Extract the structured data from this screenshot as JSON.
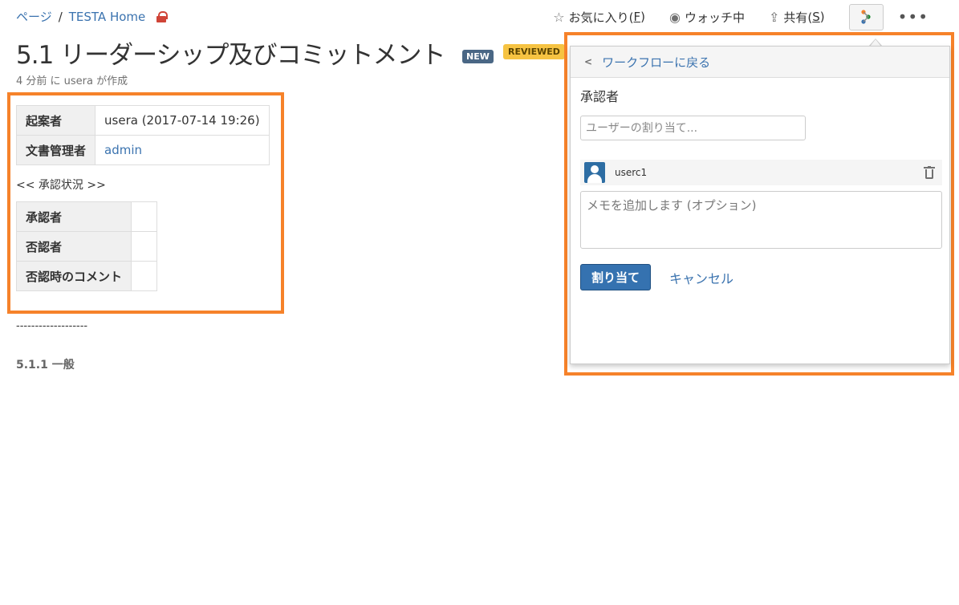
{
  "breadcrumb": {
    "pages": "ページ",
    "sep": "/",
    "space": "TESTA Home",
    "lock_icon": "lock-icon"
  },
  "actions": {
    "favorite": {
      "icon": "☆",
      "label": "お気に入り(",
      "key": "F",
      "end": ")"
    },
    "watch": {
      "icon": "◉",
      "label": "ウォッチ中"
    },
    "share": {
      "icon": "⇪",
      "label": "共有(",
      "key": "S",
      "end": ")"
    },
    "workflow_icon": "workflow-icon",
    "more": "•••"
  },
  "page": {
    "title": "5.1 リーダーシップ及びコミットメント",
    "badge_new": "NEW",
    "badge_reviewed": "REVIEWED",
    "meta": "4 分前 に usera が作成"
  },
  "info_table": [
    {
      "label": "起案者",
      "value": "usera (2017-07-14 19:26)",
      "link": false
    },
    {
      "label": "文書管理者",
      "value": "admin",
      "link": true
    }
  ],
  "status_label": "<< 承認状況 >>",
  "approval_table": [
    {
      "label": "承認者",
      "value": ""
    },
    {
      "label": "否認者",
      "value": ""
    },
    {
      "label": "否認時のコメント",
      "value": ""
    }
  ],
  "body": {
    "dashes": "-------------------",
    "subheading": "5.1.1 一般"
  },
  "panel": {
    "back": "ワークフローに戻る",
    "label": "承認者",
    "user_placeholder": "ユーザーの割り当て...",
    "assigned_user": "userc1",
    "note_placeholder": "メモを追加します (オプション)",
    "assign_button": "割り当て",
    "cancel": "キャンセル"
  },
  "colors": {
    "highlight": "#f6822a",
    "link": "#3b73af",
    "primary_button": "#3572b0"
  }
}
